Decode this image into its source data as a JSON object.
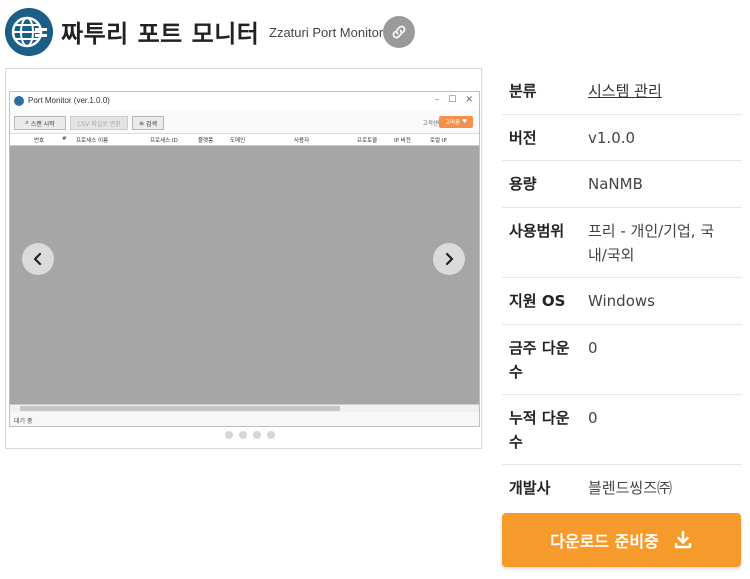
{
  "header": {
    "title": "짜투리 포트 모니터",
    "subtitle": "Zzaturi Port Monitor",
    "app_icon": "globe-icon",
    "link_icon": "link-icon"
  },
  "gallery": {
    "screenshot": {
      "window_title": "Port Monitor (ver.1.0.0)",
      "window_controls": [
        "–",
        "☐",
        "✕"
      ],
      "toolbar": {
        "start_label": "스캔 시작",
        "csv_label": "CSV 파일로 변환",
        "search_label": "검색",
        "support_label": "고객센터",
        "donate_label": "고마움"
      },
      "columns": [
        "번호",
        "#",
        "프로세스 이름",
        "프로세스 ID",
        "플랫폼",
        "도메인",
        "사용자",
        "프로토콜",
        "IP 버전",
        "로컬 IP"
      ],
      "status_text": "대기 중"
    },
    "dots_count": 4
  },
  "info": {
    "rows": [
      {
        "label": "분류",
        "value": "시스템 관리",
        "link": true
      },
      {
        "label": "버전",
        "value": "v1.0.0"
      },
      {
        "label": "용량",
        "value": "NaNMB"
      },
      {
        "label": "사용범위",
        "value_line1": "프리 - 개인/기업, 국",
        "value_line2": "내/국외"
      },
      {
        "label": "지원 OS",
        "value": "Windows"
      },
      {
        "label_line1": "금주 다운",
        "label_line2": "수",
        "value": "0"
      },
      {
        "label_line1": "누적 다운",
        "label_line2": "수",
        "value": "0"
      },
      {
        "label": "개발사",
        "value": "블렌드씽즈㈜"
      }
    ]
  },
  "download": {
    "label": "다운로드 준비중",
    "icon": "download-icon"
  },
  "colors": {
    "accent": "#f79a2c",
    "icon_blue": "#1b5f86",
    "link_gray": "#9a9a9a"
  }
}
